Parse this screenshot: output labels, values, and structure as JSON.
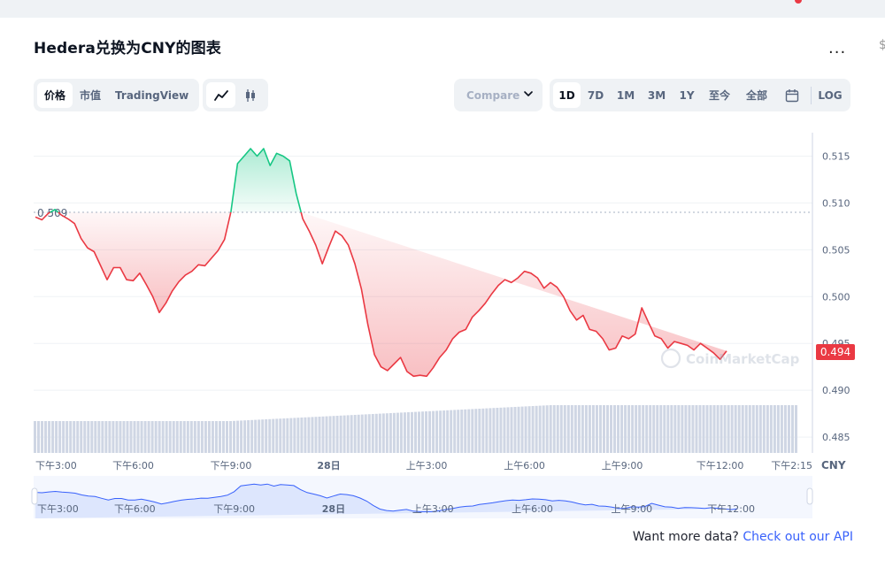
{
  "page": {
    "title": "Hedera兑换为CNY的图表",
    "more_label": "...",
    "edge_mark": "$"
  },
  "toolbar": {
    "tabs_left": [
      {
        "label": "价格",
        "active": true
      },
      {
        "label": "市值",
        "active": false
      },
      {
        "label": "TradingView",
        "active": false
      }
    ],
    "chart_types": [
      {
        "icon": "line-chart-icon",
        "active": true
      },
      {
        "icon": "candlestick-icon",
        "active": false
      }
    ],
    "compare_label": "Compare",
    "ranges": [
      {
        "label": "1D",
        "active": true
      },
      {
        "label": "7D",
        "active": false
      },
      {
        "label": "1M",
        "active": false
      },
      {
        "label": "3M",
        "active": false
      },
      {
        "label": "1Y",
        "active": false
      },
      {
        "label": "至今",
        "active": false
      },
      {
        "label": "全部",
        "active": false
      }
    ],
    "calendar_icon": "calendar-icon",
    "log_label": "LOG"
  },
  "watermark": "CoinMarketCap",
  "footer": {
    "text": "Want more data? ",
    "link": "Check out our API"
  },
  "colors": {
    "up": "#16c784",
    "down": "#ea3943",
    "brush_fill": "#dde6fd",
    "brush_line": "#3861fb"
  },
  "chart_data": {
    "type": "line",
    "currency": "CNY",
    "baseline": 0.509,
    "baseline_label": "0.509",
    "last_value": 0.494,
    "last_label": "0.494",
    "ylim": [
      0.4835,
      0.5175
    ],
    "yticks": [
      0.485,
      0.49,
      0.495,
      0.5,
      0.505,
      0.51,
      0.515
    ],
    "ytick_labels": [
      "0.485",
      "0.490",
      "0.495",
      "0.500",
      "0.505",
      "0.510",
      "0.515"
    ],
    "xlim": [
      0,
      23.4
    ],
    "xticks": [
      {
        "t": 0,
        "label": "下午3:00"
      },
      {
        "t": 3,
        "label": "下午6:00"
      },
      {
        "t": 6,
        "label": "下午9:00"
      },
      {
        "t": 9,
        "label": "28日"
      },
      {
        "t": 12,
        "label": "上午3:00"
      },
      {
        "t": 15,
        "label": "上午6:00"
      },
      {
        "t": 18,
        "label": "上午9:00"
      },
      {
        "t": 21,
        "label": "下午12:00"
      },
      {
        "t": 23.4,
        "label": "下午2:15"
      }
    ],
    "x": [
      0,
      0.2,
      0.4,
      0.6,
      0.8,
      1.0,
      1.2,
      1.4,
      1.6,
      1.8,
      2.0,
      2.2,
      2.4,
      2.6,
      2.8,
      3.0,
      3.2,
      3.4,
      3.6,
      3.8,
      4.0,
      4.2,
      4.4,
      4.6,
      4.8,
      5.0,
      5.2,
      5.4,
      5.6,
      5.8,
      6.0,
      6.2,
      6.4,
      6.6,
      6.8,
      7.0,
      7.2,
      7.4,
      7.6,
      7.8,
      8.0,
      8.2,
      8.4,
      8.6,
      8.8,
      9.0,
      9.2,
      9.4,
      9.6,
      9.8,
      10.0,
      10.2,
      10.4,
      10.6,
      10.8,
      11.0,
      11.2,
      11.4,
      11.6,
      11.8,
      12.0,
      12.2,
      12.4,
      12.6,
      12.8,
      13.0,
      13.2,
      13.4,
      13.6,
      13.8,
      14.0,
      14.2,
      14.4,
      14.6,
      14.8,
      15.0,
      15.2,
      15.4,
      15.6,
      15.8,
      16.0,
      16.2,
      16.4,
      16.6,
      16.8,
      17.0,
      17.2,
      17.4,
      17.6,
      17.8,
      18.0,
      18.2,
      18.4,
      18.6,
      18.8,
      19.0,
      19.2,
      19.4,
      19.6,
      19.8,
      20.0,
      20.2,
      20.4,
      20.6,
      20.8,
      21.0,
      21.2,
      21.4,
      21.6,
      21.8,
      22.0,
      22.2,
      22.4,
      22.6,
      22.8,
      23.0,
      23.2,
      23.4
    ],
    "y": [
      0.5085,
      0.5082,
      0.5089,
      0.5093,
      0.5087,
      0.5083,
      0.5078,
      0.5062,
      0.5052,
      0.5048,
      0.5033,
      0.5018,
      0.5031,
      0.5031,
      0.5018,
      0.5017,
      0.5025,
      0.5013,
      0.5,
      0.4983,
      0.4993,
      0.5006,
      0.5016,
      0.5023,
      0.5027,
      0.5034,
      0.5033,
      0.5041,
      0.5049,
      0.5061,
      0.5091,
      0.5142,
      0.515,
      0.5158,
      0.515,
      0.5158,
      0.514,
      0.5153,
      0.515,
      0.5145,
      0.511,
      0.5083,
      0.507,
      0.5055,
      0.5035,
      0.5053,
      0.507,
      0.5065,
      0.5055,
      0.5035,
      0.5008,
      0.497,
      0.4938,
      0.4925,
      0.4921,
      0.4928,
      0.4935,
      0.492,
      0.4915,
      0.4916,
      0.4915,
      0.4924,
      0.4935,
      0.4943,
      0.4955,
      0.4962,
      0.4965,
      0.4978,
      0.4985,
      0.4993,
      0.5003,
      0.5012,
      0.5018,
      0.5015,
      0.502,
      0.5027,
      0.5025,
      0.502,
      0.5009,
      0.5015,
      0.501,
      0.5,
      0.4985,
      0.4975,
      0.498,
      0.4965,
      0.4963,
      0.4955,
      0.4943,
      0.4945,
      0.4958,
      0.4955,
      0.496,
      0.4988,
      0.4973,
      0.4958,
      0.4955,
      0.4945,
      0.4952,
      0.495,
      0.4948,
      0.4943,
      0.495,
      0.4945,
      0.494,
      0.4933,
      0.4942
    ],
    "volume_label": "",
    "brush_xticks": [
      {
        "t": 0,
        "label": "下午3:00"
      },
      {
        "t": 3,
        "label": "下午6:00"
      },
      {
        "t": 6,
        "label": "下午9:00"
      },
      {
        "t": 9,
        "label": "28日"
      },
      {
        "t": 12,
        "label": "上午3:00"
      },
      {
        "t": 15,
        "label": "上午6:00"
      },
      {
        "t": 18,
        "label": "上午9:00"
      },
      {
        "t": 21,
        "label": "下午12:00"
      }
    ]
  }
}
